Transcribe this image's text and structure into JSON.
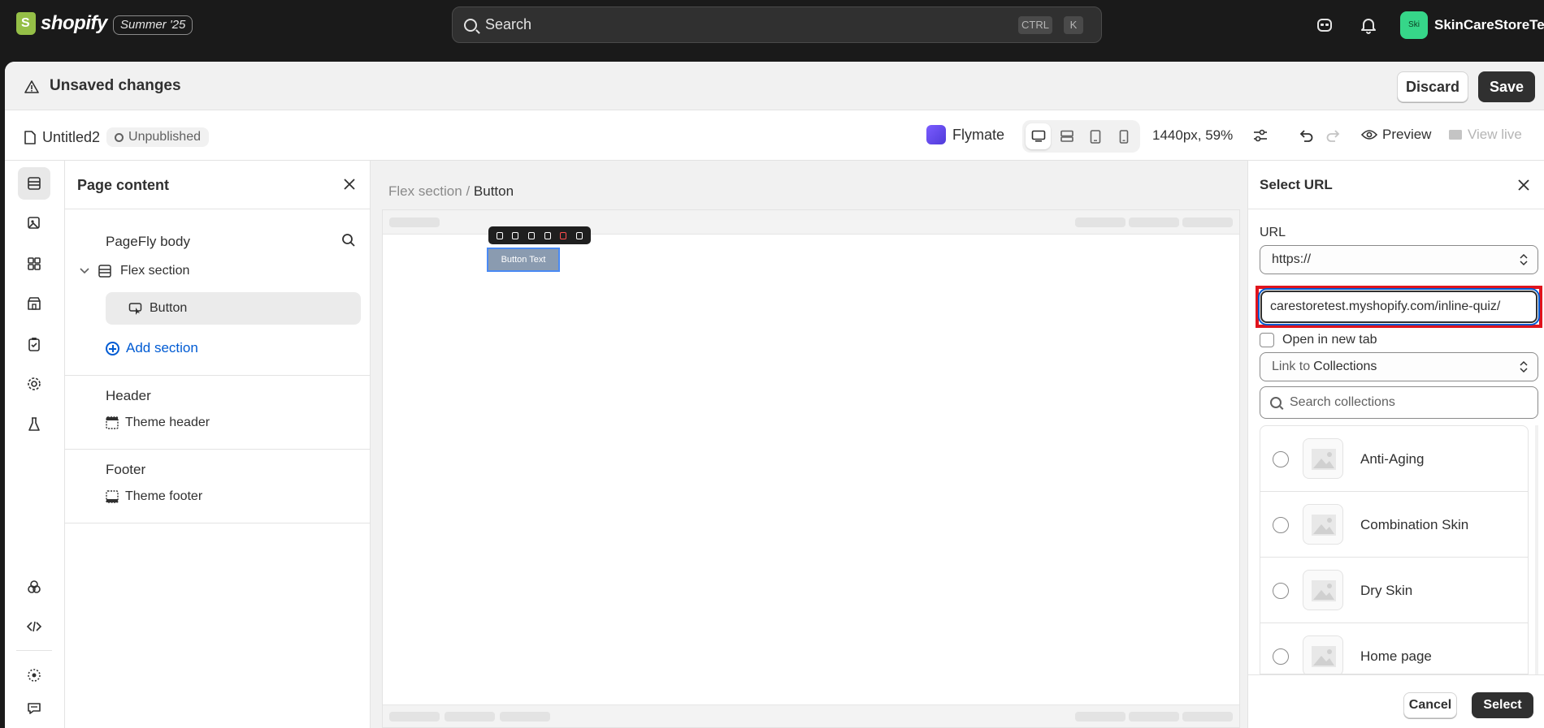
{
  "topbar": {
    "logo_text": "shopify",
    "edition": "Summer '25",
    "search_placeholder": "Search",
    "shortcut_ctrl": "CTRL",
    "shortcut_key": "K",
    "store_avatar": "Ski",
    "store_name": "SkinCareStoreTest",
    "store_avatar_color": "#36d689"
  },
  "unsaved_bar": {
    "title": "Unsaved changes",
    "discard_label": "Discard",
    "save_label": "Save"
  },
  "toolbar": {
    "page_name": "Untitled2",
    "status": "Unpublished",
    "app_name": "Flymate",
    "zoom": "1440px, 59%",
    "preview_label": "Preview",
    "view_live_label": "View live",
    "devices": [
      "desktop-icon",
      "laptop-icon",
      "tablet-icon",
      "mobile-icon"
    ],
    "active_device": "desktop-icon"
  },
  "left_rail": {
    "icons": [
      "sections-icon",
      "media-icon",
      "elements-icon",
      "store-icon",
      "clipboard-check-icon",
      "gear-icon",
      "flask-icon",
      "apps-icon",
      "code-icon",
      "settings-dots-icon",
      "chat-icon"
    ],
    "active": "sections-icon"
  },
  "page_content": {
    "title": "Page content",
    "body_label": "PageFly body",
    "flex_section": "Flex section",
    "button_item": "Button",
    "add_section": "Add section",
    "header_title": "Header",
    "header_item": "Theme header",
    "footer_title": "Footer",
    "footer_item": "Theme footer"
  },
  "canvas": {
    "breadcrumb_parent": "Flex section",
    "breadcrumb_sep": "/",
    "breadcrumb_current": "Button",
    "button_text": "Button Text"
  },
  "select_url": {
    "title": "Select URL",
    "url_label": "URL",
    "protocol": "https://",
    "url_value": "carestoretest.myshopify.com/inline-quiz/",
    "open_new_tab": "Open in new tab",
    "link_to_prefix": "Link to",
    "link_to_value": "Collections",
    "search_placeholder": "Search collections",
    "collections": [
      {
        "name": "Anti-Aging"
      },
      {
        "name": "Combination Skin"
      },
      {
        "name": "Dry Skin"
      },
      {
        "name": "Home page"
      }
    ],
    "cancel_label": "Cancel",
    "select_label": "Select",
    "highlight_color": "#e0141d"
  }
}
